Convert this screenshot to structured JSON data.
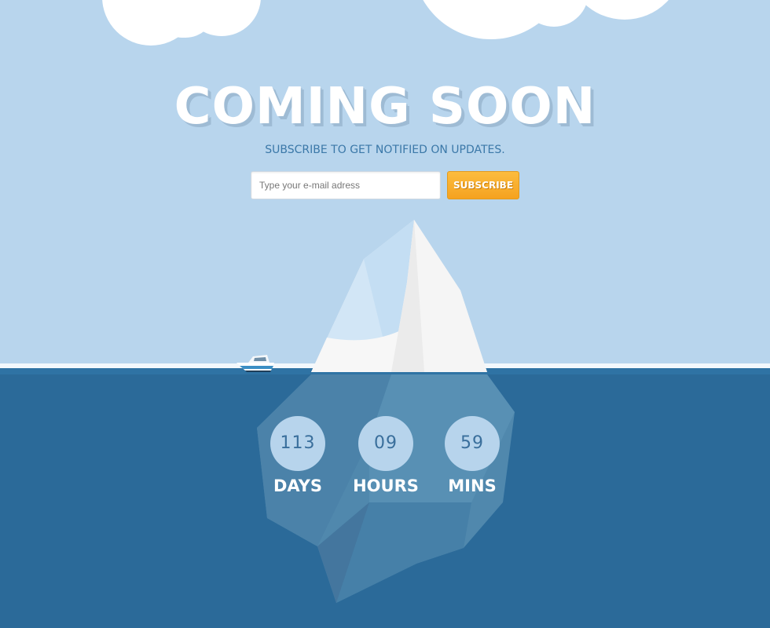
{
  "page": {
    "title": "COMING SOON",
    "subtitle": "SUBSCRIBE TO GET NOTIFIED ON UPDATES."
  },
  "form": {
    "email_placeholder": "Type your e-mail adress",
    "subscribe_label": "SUBSCRIBE"
  },
  "countdown": {
    "days": {
      "value": "113",
      "label": "DAYS"
    },
    "hours": {
      "value": "09",
      "label": "HOURS"
    },
    "mins": {
      "value": "59",
      "label": "MINS"
    }
  },
  "colors": {
    "sky": "#b8d5ed",
    "sea": "#2b6a99",
    "accent": "#f5a21f",
    "title_text": "#ffffff",
    "subtitle_text": "#3b78a8"
  },
  "icons": [
    "cloud-icon",
    "iceberg-icon",
    "boat-icon"
  ]
}
